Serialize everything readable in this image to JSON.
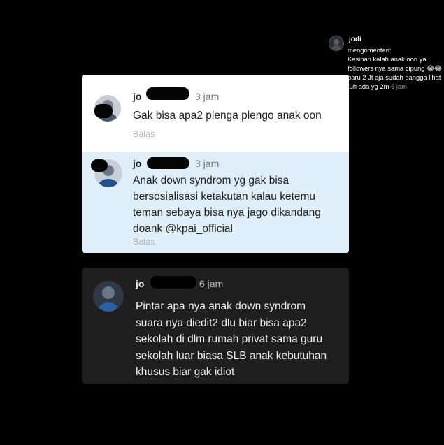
{
  "notification": {
    "username": "jodi",
    "action": "mengomentari:",
    "message": "Kasihan kalah anak oon ya followers nya sama cipung 😂😂 baru 2 Jt aja sudah bangga lihat tuh ada yg 2m",
    "time": "5 jam"
  },
  "comments": [
    {
      "username": "jo",
      "time": "3 jam",
      "text": "Gak bisa apa2 plenga plengo anak oon",
      "reply_label": "Balas"
    },
    {
      "username": "jo",
      "time": "3 jam",
      "text_lines": [
        "Anak down syndrom yg gak bisa",
        "bersosialisasi ketakutan kalau ketemu",
        "teman sebaya bisa nya jago dikandang",
        "doank @kpai_official"
      ],
      "reply_label": "Balas"
    },
    {
      "username": "jo",
      "time": "6 jam",
      "text_lines": [
        "Pintar apa nya anak down syndrom",
        "suara nya diedit2 dlu biar bisa apa2",
        "sekolah di dlm rumah privat sama guru",
        "sekolah luar biasa SLB anak kebutuhan",
        "khusus biar gak idiot"
      ]
    }
  ]
}
